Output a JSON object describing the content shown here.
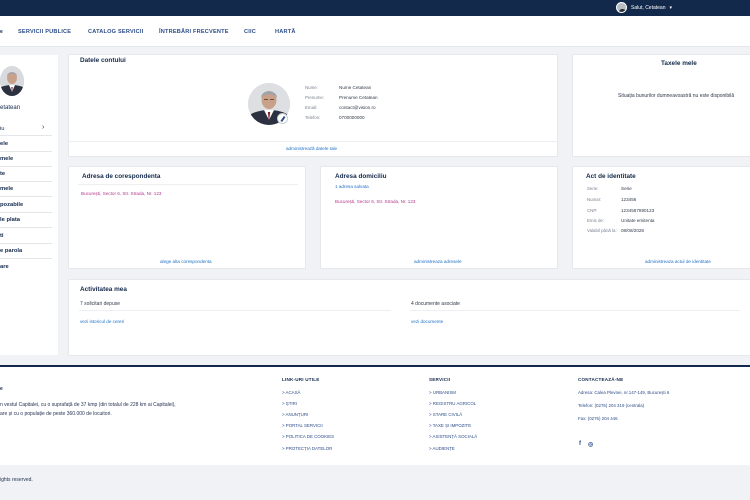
{
  "header": {
    "user_name": "Salut, Cetatean",
    "caret": "▾",
    "logo_fragment": "e"
  },
  "nav": {
    "items": [
      {
        "label": "SERVICII PUBLICE"
      },
      {
        "label": "CATALOG SERVICII"
      },
      {
        "label": "ÎNTREBĂRI FRECVENTE"
      },
      {
        "label": "CIIC"
      },
      {
        "label": "HARTĂ"
      }
    ]
  },
  "sidebar": {
    "name_fragment": "etatean",
    "chevron": "›",
    "items": [
      {
        "label": "iu"
      },
      {
        "label": "ele"
      },
      {
        "label": "mele"
      },
      {
        "label": "te"
      },
      {
        "label": "mele"
      },
      {
        "label": "pozabile"
      },
      {
        "label": "le plata"
      },
      {
        "label": "ti"
      },
      {
        "label": "e parola"
      },
      {
        "label": "are"
      }
    ]
  },
  "account": {
    "title": "Datele contului",
    "fields": [
      {
        "label": "Nume:",
        "value": "Nume Cetatean"
      },
      {
        "label": "Prenume:",
        "value": "Prenume Cetatean"
      },
      {
        "label": "Email:",
        "value": "contact@vision.ro"
      },
      {
        "label": "Telefon:",
        "value": "0700000000"
      }
    ],
    "link": "administrează datele tale"
  },
  "taxes": {
    "title": "Taxele mele",
    "message": "Situația bunurilor dumneavoastră nu este disponibilă"
  },
  "correspondence": {
    "title": "Adresa de corespondenta",
    "address": "București, Sector 6, Str. Strada, Nr. 123",
    "link": "alege alta corespondenta"
  },
  "domicile": {
    "title": "Adresa domiciliu",
    "count": "1 adresa salvata",
    "address": "București, Sector 6, Str. Strada, Nr. 123",
    "link": "administreaza adresele"
  },
  "identity": {
    "title": "Act de identitate",
    "fields": [
      {
        "label": "Serie:",
        "value": "Serie"
      },
      {
        "label": "Numar:",
        "value": "123456"
      },
      {
        "label": "CNP:",
        "value": "1234567890123"
      },
      {
        "label": "Emis de:",
        "value": "Unitate emitenta"
      },
      {
        "label": "Valabil până la:",
        "value": "08/08/2028"
      }
    ],
    "link": "administreaza actul de identitate"
  },
  "activity": {
    "title": "Activitatea mea",
    "requests": "7 solicitari depuse",
    "requests_link": "vezi istoricul de cereri",
    "documents": "4 documente asociate",
    "documents_link": "vezi documente"
  },
  "footer": {
    "logo_fragment": "e",
    "description_line1": "n vestul Capitalei, cu o suprafață de 37 kmp (din totalul de 228 km ai Capitalei),",
    "description_line2": "are și cu o populație de peste 360.000 de locuitori.",
    "useful_links_title": "LINK-URI UTILE",
    "useful_links": [
      "> ACASĂ",
      "> ȘTIRI",
      "> ANUNȚURI",
      "> PORTAL SERVICII",
      "> POLITICA DE COOKIES",
      "> PROTECȚIA DATELOR"
    ],
    "services_title": "SERVICII",
    "services": [
      "> URBANISM",
      "> REGISTRU AGRICOL",
      "> STARE CIVILĂ",
      "> TAXE ȘI IMPOZITE",
      "> ASISTENȚĂ SOCIALĂ",
      "> AUDIENȚE"
    ],
    "contact_title": "CONTACTEAZĂ-NE",
    "address": "Adresa: Calea Plevnei, nr.147-149, București 6",
    "phone": "Telefon: (0276) 204 319 (centrala)",
    "fax": "Fax: (0276) 204 446",
    "social": [
      "f",
      "◎"
    ],
    "copyright": "ights reserved."
  }
}
